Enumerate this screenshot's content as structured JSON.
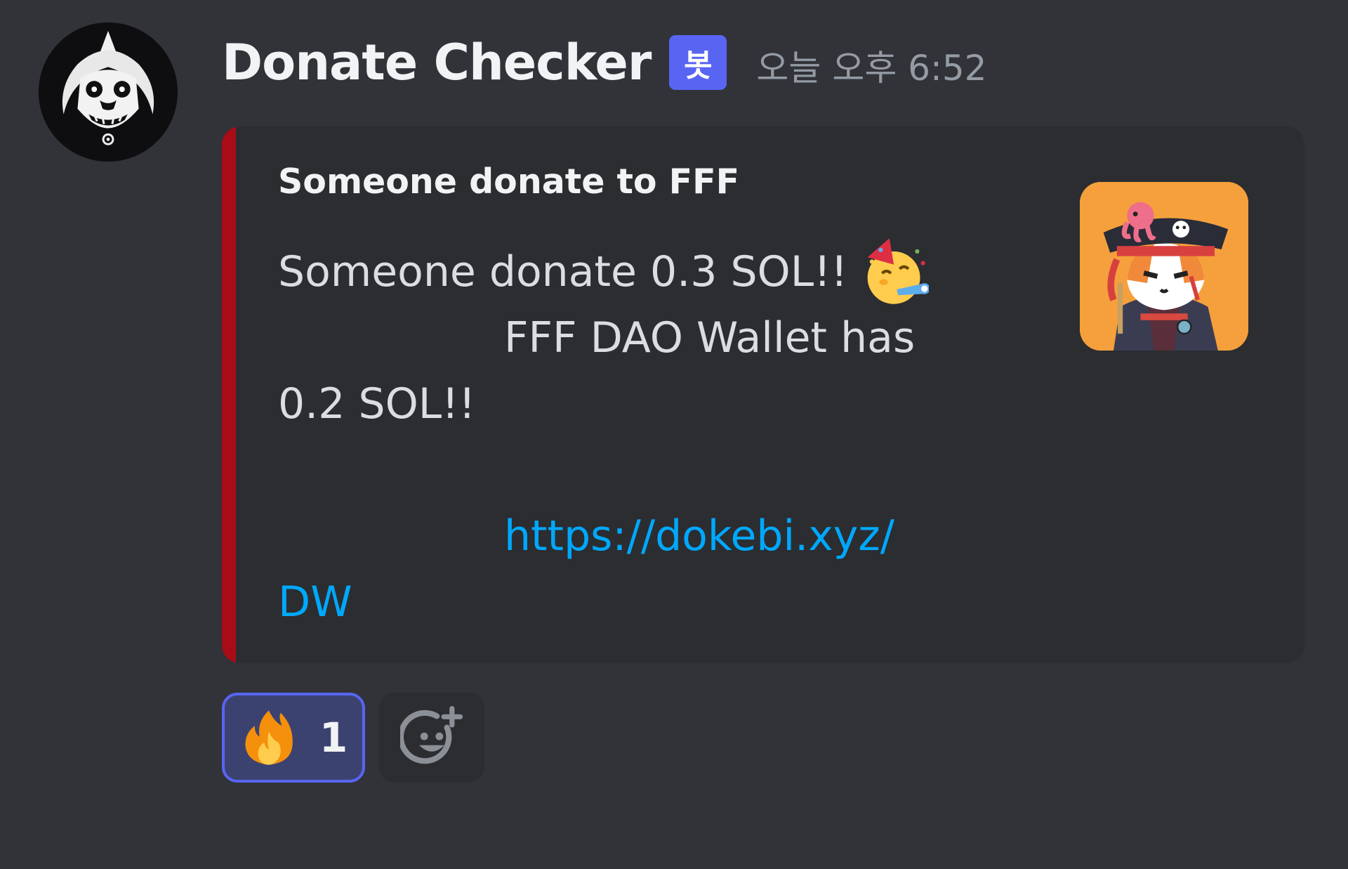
{
  "message": {
    "author": "Donate Checker",
    "bot_tag": "봇",
    "timestamp": "오늘 오후 6:52",
    "avatar_icon": "dokkaebi-mask-avatar"
  },
  "embed": {
    "accent_color": "#a80c17",
    "title": "Someone donate to FFF",
    "line1": "Someone donate 0.3 SOL!!",
    "line1_emoji": "partying-face-emoji",
    "line2": "FFF DAO Wallet has",
    "line3": "0.2 SOL!!",
    "link_part1": "https://dokebi.xyz/",
    "link_part2": "DW",
    "thumbnail_icon": "pirate-fox-nft-thumbnail"
  },
  "reactions": [
    {
      "emoji": "fire-emoji",
      "count": "1",
      "active": true
    }
  ],
  "add_reaction_icon": "add-reaction-icon",
  "colors": {
    "background": "#323339",
    "embed_background": "#2b2d31",
    "bot_tag": "#5865f2",
    "link": "#00a8fc",
    "reaction_active_border": "#5865f2"
  }
}
